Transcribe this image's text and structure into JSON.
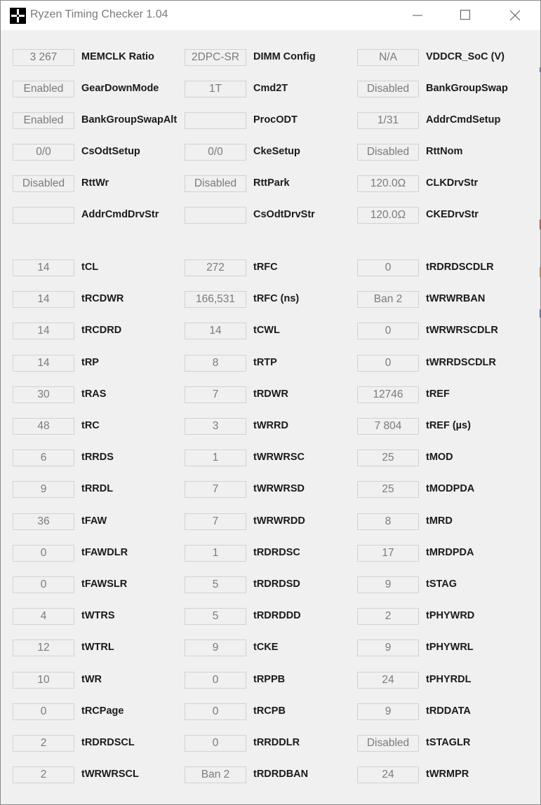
{
  "window": {
    "title": "Ryzen Timing Checker 1.04",
    "accent": "#000000",
    "controls": [
      "minimize-icon",
      "maximize-icon",
      "close-icon"
    ]
  },
  "config_rows": [
    [
      {
        "value": "3 267",
        "label": "MEMCLK Ratio"
      },
      {
        "value": "2DPC-SR",
        "label": "DIMM Config"
      },
      {
        "value": "N/A",
        "label": "VDDCR_SoC (V)"
      }
    ],
    [
      {
        "value": "Enabled",
        "label": "GearDownMode"
      },
      {
        "value": "1T",
        "label": "Cmd2T"
      },
      {
        "value": "Disabled",
        "label": "BankGroupSwap"
      }
    ],
    [
      {
        "value": "Enabled",
        "label": "BankGroupSwapAlt"
      },
      {
        "value": "",
        "label": "ProcODT"
      },
      {
        "value": "1/31",
        "label": "AddrCmdSetup"
      }
    ],
    [
      {
        "value": "0/0",
        "label": "CsOdtSetup"
      },
      {
        "value": "0/0",
        "label": "CkeSetup"
      },
      {
        "value": "Disabled",
        "label": "RttNom"
      }
    ],
    [
      {
        "value": "Disabled",
        "label": "RttWr"
      },
      {
        "value": "Disabled",
        "label": "RttPark"
      },
      {
        "value": "120.0Ω",
        "label": "CLKDrvStr"
      }
    ],
    [
      {
        "value": "",
        "label": "AddrCmdDrvStr"
      },
      {
        "value": "",
        "label": "CsOdtDrvStr"
      },
      {
        "value": "120.0Ω",
        "label": "CKEDrvStr"
      }
    ]
  ],
  "timing_rows": [
    [
      {
        "value": "14",
        "label": "tCL"
      },
      {
        "value": "272",
        "label": "tRFC"
      },
      {
        "value": "0",
        "label": "tRDRDSCDLR"
      }
    ],
    [
      {
        "value": "14",
        "label": "tRCDWR"
      },
      {
        "value": "166,531",
        "label": "tRFC (ns)"
      },
      {
        "value": "Ban 2",
        "label": "tWRWRBAN"
      }
    ],
    [
      {
        "value": "14",
        "label": "tRCDRD"
      },
      {
        "value": "14",
        "label": "tCWL"
      },
      {
        "value": "0",
        "label": "tWRWRSCDLR"
      }
    ],
    [
      {
        "value": "14",
        "label": "tRP"
      },
      {
        "value": "8",
        "label": "tRTP"
      },
      {
        "value": "0",
        "label": "tWRRDSCDLR"
      }
    ],
    [
      {
        "value": "30",
        "label": "tRAS"
      },
      {
        "value": "7",
        "label": "tRDWR"
      },
      {
        "value": "12746",
        "label": "tREF"
      }
    ],
    [
      {
        "value": "48",
        "label": "tRC"
      },
      {
        "value": "3",
        "label": "tWRRD"
      },
      {
        "value": "7 804",
        "label": "tREF (µs)"
      }
    ],
    [
      {
        "value": "6",
        "label": "tRRDS"
      },
      {
        "value": "1",
        "label": "tWRWRSC"
      },
      {
        "value": "25",
        "label": "tMOD"
      }
    ],
    [
      {
        "value": "9",
        "label": "tRRDL"
      },
      {
        "value": "7",
        "label": "tWRWRSD"
      },
      {
        "value": "25",
        "label": "tMODPDA"
      }
    ],
    [
      {
        "value": "36",
        "label": "tFAW"
      },
      {
        "value": "7",
        "label": "tWRWRDD"
      },
      {
        "value": "8",
        "label": "tMRD"
      }
    ],
    [
      {
        "value": "0",
        "label": "tFAWDLR"
      },
      {
        "value": "1",
        "label": "tRDRDSC"
      },
      {
        "value": "17",
        "label": "tMRDPDA"
      }
    ],
    [
      {
        "value": "0",
        "label": "tFAWSLR"
      },
      {
        "value": "5",
        "label": "tRDRDSD"
      },
      {
        "value": "9",
        "label": "tSTAG"
      }
    ],
    [
      {
        "value": "4",
        "label": "tWTRS"
      },
      {
        "value": "5",
        "label": "tRDRDDD"
      },
      {
        "value": "2",
        "label": "tPHYWRD"
      }
    ],
    [
      {
        "value": "12",
        "label": "tWTRL"
      },
      {
        "value": "9",
        "label": "tCKE"
      },
      {
        "value": "9",
        "label": "tPHYWRL"
      }
    ],
    [
      {
        "value": "10",
        "label": "tWR"
      },
      {
        "value": "0",
        "label": "tRPPB"
      },
      {
        "value": "24",
        "label": "tPHYRDL"
      }
    ],
    [
      {
        "value": "0",
        "label": "tRCPage"
      },
      {
        "value": "0",
        "label": "tRCPB"
      },
      {
        "value": "9",
        "label": "tRDDATA"
      }
    ],
    [
      {
        "value": "2",
        "label": "tRDRDSCL"
      },
      {
        "value": "0",
        "label": "tRRDDLR"
      },
      {
        "value": "Disabled",
        "label": "tSTAGLR"
      }
    ],
    [
      {
        "value": "2",
        "label": "tWRWRSCL"
      },
      {
        "value": "Ban 2",
        "label": "tRDRDBAN"
      },
      {
        "value": "24",
        "label": "tWRMPR"
      }
    ]
  ]
}
